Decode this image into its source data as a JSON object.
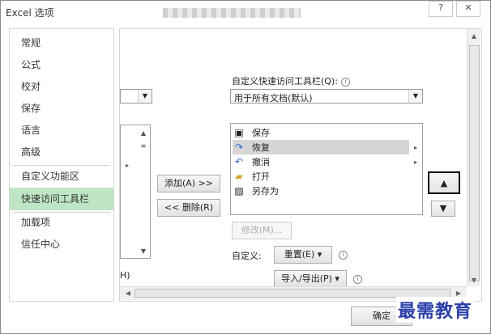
{
  "window": {
    "title": "Excel 选项",
    "help_label": "?",
    "close_label": "✕"
  },
  "sidebar": {
    "items": [
      {
        "label": "常规"
      },
      {
        "label": "公式"
      },
      {
        "label": "校对"
      },
      {
        "label": "保存"
      },
      {
        "label": "语言"
      },
      {
        "label": "高级"
      },
      {
        "label": "自定义功能区"
      },
      {
        "label": "快速访问工具栏",
        "selected": true
      },
      {
        "label": "加载项"
      },
      {
        "label": "信任中心"
      }
    ]
  },
  "qat": {
    "customize_label": "自定义快速访问工具栏(Q):",
    "scope_value": "用于所有文档(默认)",
    "items": [
      {
        "label": "保存",
        "icon": "save-icon"
      },
      {
        "label": "恢复",
        "icon": "redo-icon",
        "selected": true
      },
      {
        "label": "撤消",
        "icon": "undo-icon"
      },
      {
        "label": "打开",
        "icon": "folder-icon"
      },
      {
        "label": "另存为",
        "icon": "save-as-icon"
      }
    ],
    "add_label": "添加(A) >>",
    "remove_label": "<< 删除(R)",
    "modify_label": "修改(M)...",
    "custom_label": "自定义:",
    "reset_label": "重置(E) ▾",
    "import_export_label": "导入/导出(P) ▾"
  },
  "left_partial": {
    "hide_label": "H)"
  },
  "footer": {
    "ok_label": "确定"
  },
  "watermark": "最需教育",
  "colors": {
    "selected_bg": "#bfe6c4",
    "highlight_box": "#000000"
  }
}
